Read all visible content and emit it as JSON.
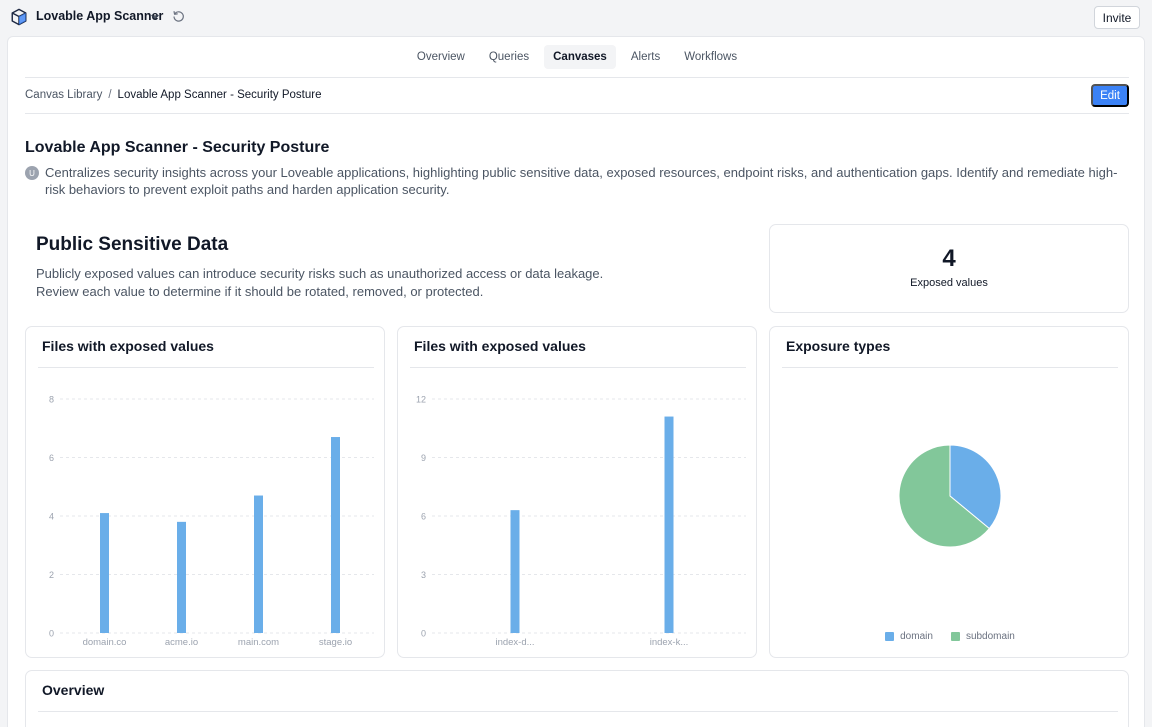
{
  "app": {
    "name": "Lovable App Scanner",
    "invite_label": "Invite"
  },
  "tabs": [
    {
      "label": "Overview",
      "active": false
    },
    {
      "label": "Queries",
      "active": false
    },
    {
      "label": "Canvases",
      "active": true
    },
    {
      "label": "Alerts",
      "active": false
    },
    {
      "label": "Workflows",
      "active": false
    }
  ],
  "breadcrumb": {
    "library": "Canvas Library",
    "separator": "/",
    "current": "Lovable App Scanner - Security Posture"
  },
  "edit_label": "Edit",
  "page": {
    "title": "Lovable App Scanner - Security Posture",
    "author_initial": "U",
    "description": "Centralizes security insights across your Loveable applications, highlighting public sensitive data, exposed resources, endpoint risks, and authentication gaps. Identify and remediate high-risk behaviors to prevent exploit paths and harden application security."
  },
  "section": {
    "title": "Public Sensitive Data",
    "description_line1": "Publicly exposed values can introduce security risks such as unauthorized access or data leakage.",
    "description_line2": "Review each value to determine if it should be rotated, removed, or protected."
  },
  "stat": {
    "value": "4",
    "label": "Exposed values"
  },
  "colors": {
    "accent": "#3b82f6",
    "bar": "#6aaee9",
    "pie_domain": "#6aaee9",
    "pie_subdomain": "#82c79a"
  },
  "chart_data": [
    {
      "type": "bar",
      "title": "Files with exposed values",
      "categories": [
        "domain.co",
        "acme.io",
        "main.com",
        "stage.io"
      ],
      "values": [
        4.1,
        3.8,
        4.7,
        6.7
      ],
      "ylim": [
        0,
        8
      ],
      "yticks": [
        "0",
        "2",
        "4",
        "6",
        "8"
      ],
      "grid": true
    },
    {
      "type": "bar",
      "title": "Files with exposed values",
      "categories": [
        "index-d...",
        "index-k..."
      ],
      "values": [
        6.3,
        11.1
      ],
      "ylim": [
        0,
        12
      ],
      "yticks": [
        "0",
        "3",
        "6",
        "9",
        "12"
      ],
      "grid": true
    },
    {
      "type": "pie",
      "title": "Exposure types",
      "categories": [
        "domain",
        "subdomain"
      ],
      "values": [
        36,
        64
      ],
      "legend": "bottom"
    }
  ],
  "overview": {
    "title": "Overview"
  }
}
